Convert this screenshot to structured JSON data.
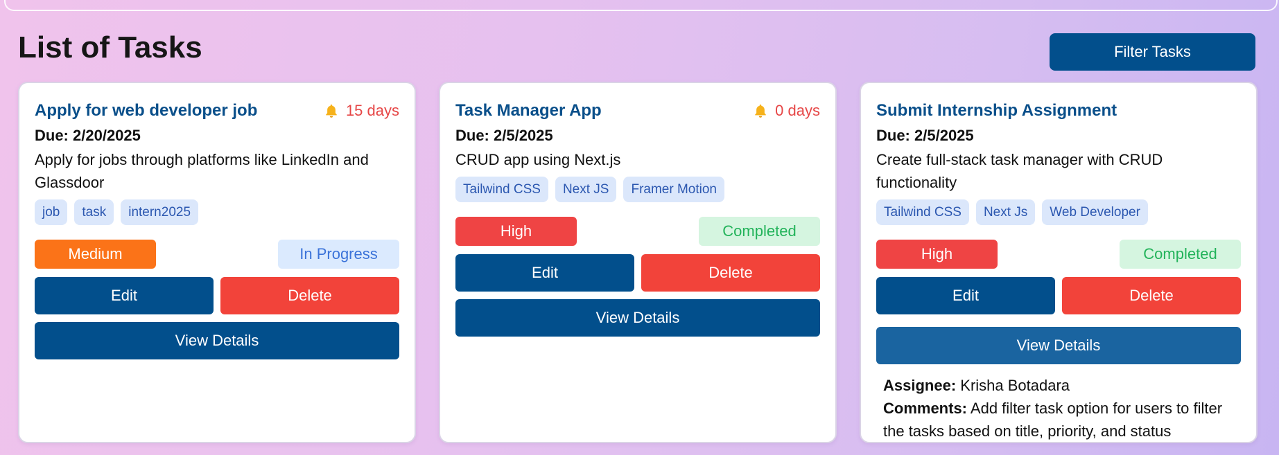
{
  "header": {
    "title": "List of Tasks",
    "filter_label": "Filter Tasks"
  },
  "colors": {
    "primary": "#024f8c",
    "danger": "#f2433a",
    "priority_medium": "#fb7318",
    "priority_high": "#ef4444",
    "status_in_progress_bg": "#dbeafe",
    "status_in_progress_text": "#3b73d9",
    "status_completed_bg": "#d5f5e0",
    "status_completed_text": "#22b35a",
    "reminder": "#e64646",
    "tag_bg": "#dbe7fb",
    "tag_text": "#2b57b0"
  },
  "tasks": [
    {
      "title": "Apply for web developer job",
      "reminder_icon": "bell-icon",
      "reminder": "15 days",
      "due_label": "Due:",
      "due_date": "2/20/2025",
      "description": "Apply for jobs through platforms like LinkedIn and Glassdoor",
      "tags": [
        "job",
        "task",
        "intern2025"
      ],
      "priority": "Medium",
      "status": "In Progress",
      "edit_label": "Edit",
      "delete_label": "Delete",
      "view_label": "View Details"
    },
    {
      "title": "Task Manager App",
      "reminder_icon": "bell-icon",
      "reminder": "0 days",
      "due_label": "Due:",
      "due_date": "2/5/2025",
      "description": "CRUD app using Next.js",
      "tags": [
        "Tailwind CSS",
        "Next JS",
        "Framer Motion"
      ],
      "priority": "High",
      "status": "Completed",
      "edit_label": "Edit",
      "delete_label": "Delete",
      "view_label": "View Details"
    },
    {
      "title": "Submit Internship Assignment",
      "due_label": "Due:",
      "due_date": "2/5/2025",
      "description": "Create full-stack task manager with CRUD functionality",
      "tags": [
        "Tailwind CSS",
        "Next Js",
        "Web Developer"
      ],
      "priority": "High",
      "status": "Completed",
      "edit_label": "Edit",
      "delete_label": "Delete",
      "view_label": "View Details",
      "details": {
        "assignee_label": "Assignee:",
        "assignee": "Krisha Botadara",
        "comments_label": "Comments:",
        "comments": "Add filter task option for users to filter the tasks based on title, priority, and status"
      }
    }
  ]
}
